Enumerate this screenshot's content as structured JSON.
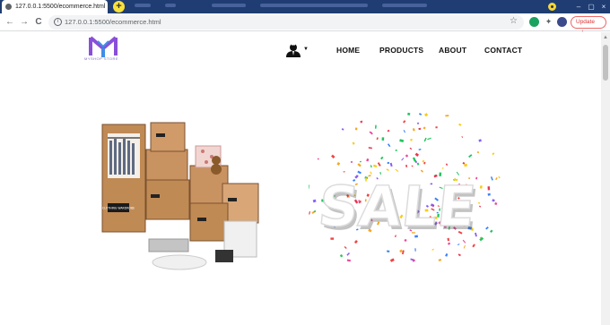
{
  "browser": {
    "tab_title": "127.0.0.1:5500/ecommerce.html",
    "tab_close": "×",
    "new_tab": "+",
    "url": "127.0.0.1:5500/ecommerce.html",
    "update_label": "Update",
    "update_more": "⋮",
    "win_minimize": "–",
    "win_maximize": "▢",
    "win_close": "×",
    "back": "←",
    "forward": "→",
    "reload": "C",
    "info": "i",
    "star": "☆",
    "extensions": "✦"
  },
  "site": {
    "brand_text": "MYSHOP STORE",
    "nav": {
      "home": "HOME",
      "products": "PRODUCTS",
      "about": "ABOUT",
      "contact": "CONTACT"
    },
    "user_caret": "▼",
    "sale_text": "SALE",
    "box_label_wardrobe": "CLOTHING WARDROBE"
  },
  "colors": {
    "tabbar": "#1f3d73",
    "logo_accent": "#8a4fd8",
    "logo_accent_2": "#3f8de6"
  }
}
